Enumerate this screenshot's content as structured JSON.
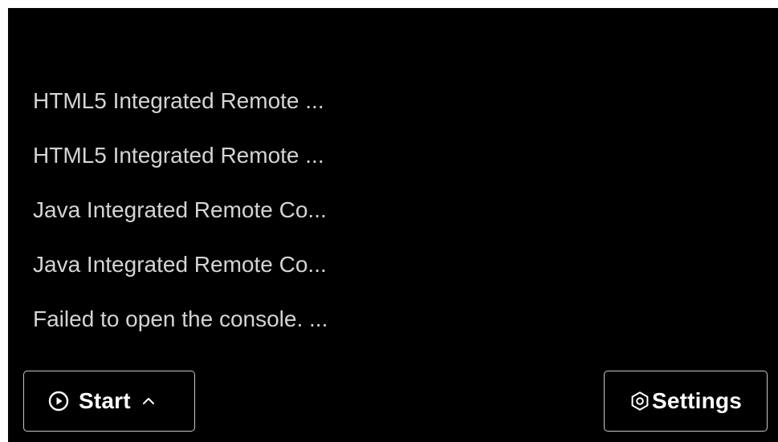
{
  "menu": {
    "items": [
      {
        "label": "HTML5 Integrated Remote ..."
      },
      {
        "label": "HTML5 Integrated Remote ..."
      },
      {
        "label": "Java Integrated Remote Co..."
      },
      {
        "label": "Java Integrated Remote Co..."
      },
      {
        "label": "Failed to open the console. ..."
      }
    ]
  },
  "buttons": {
    "start_label": "Start",
    "start_icon": "play-circle-icon",
    "start_chevron_icon": "chevron-up-icon",
    "settings_label": "Settings",
    "settings_icon": "settings-gear-icon"
  },
  "colors": {
    "background": "#000000",
    "menu_text": "#d4d4d4",
    "button_border": "#c8c8c8",
    "button_text": "#ffffff"
  }
}
